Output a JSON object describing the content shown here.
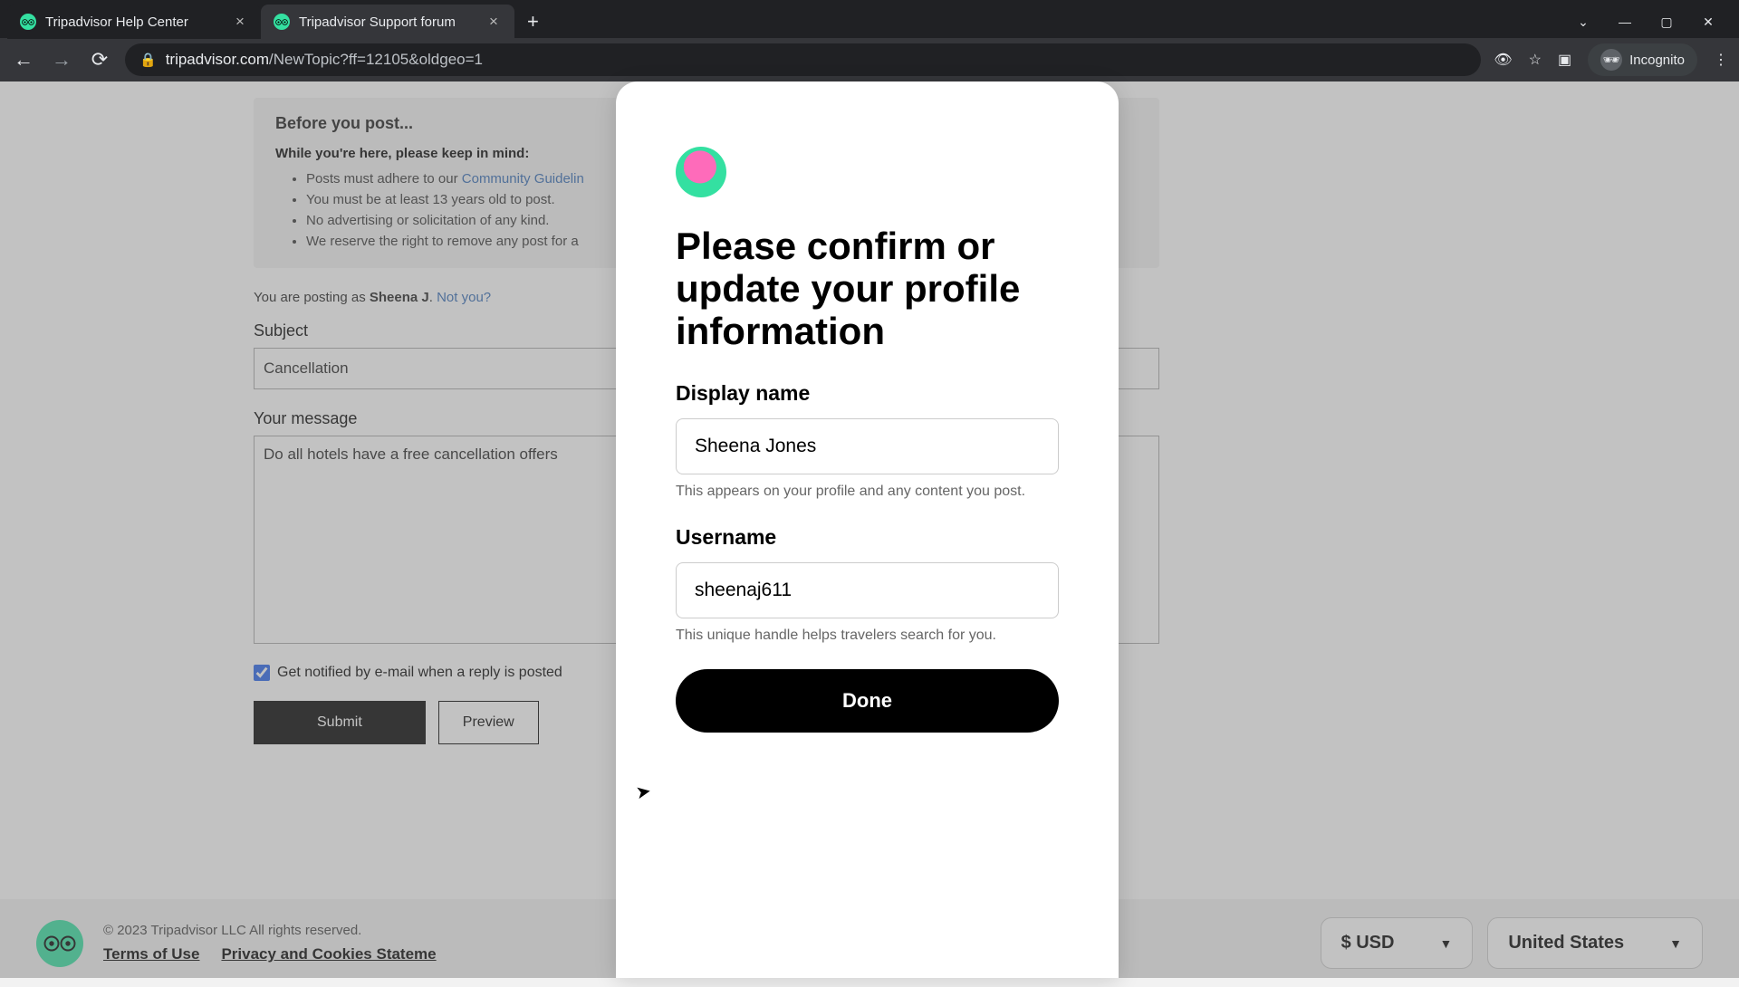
{
  "browser": {
    "tabs": [
      {
        "title": "Tripadvisor Help Center"
      },
      {
        "title": "Tripadvisor Support forum"
      }
    ],
    "url_domain": "tripadvisor.com",
    "url_path": "/NewTopic?ff=12105&oldgeo=1",
    "incognito_label": "Incognito"
  },
  "info_box": {
    "heading": "Before you post...",
    "subheading": "While you're here, please keep in mind:",
    "items": [
      "Posts must adhere to our ",
      "You must be at least 13 years old to post.",
      "No advertising or solicitation of any kind.",
      "We reserve the right to remove any post for a"
    ],
    "guidelines_link": "Community Guidelin"
  },
  "posting_as": {
    "prefix": "You are posting as ",
    "name": "Sheena J",
    "suffix": ". ",
    "not_you": "Not you?"
  },
  "form": {
    "subject_label": "Subject",
    "subject_value": "Cancellation",
    "message_label": "Your message",
    "message_value": "Do all hotels have a free cancellation offers",
    "notify_label": "Get notified by e-mail when a reply is posted",
    "submit_label": "Submit",
    "preview_label": "Preview"
  },
  "footer": {
    "copyright": "© 2023 Tripadvisor LLC All rights reserved.",
    "links": {
      "terms": "Terms of Use",
      "privacy": "Privacy and Cookies Stateme"
    },
    "currency": "$ USD",
    "region": "United States"
  },
  "modal": {
    "title": "Please confirm or update your profile information",
    "display_name_label": "Display name",
    "display_name_value": "Sheena Jones",
    "display_name_hint": "This appears on your profile and any content you post.",
    "username_label": "Username",
    "username_value": "sheenaj611",
    "username_hint": "This unique handle helps travelers search for you.",
    "done_label": "Done"
  }
}
